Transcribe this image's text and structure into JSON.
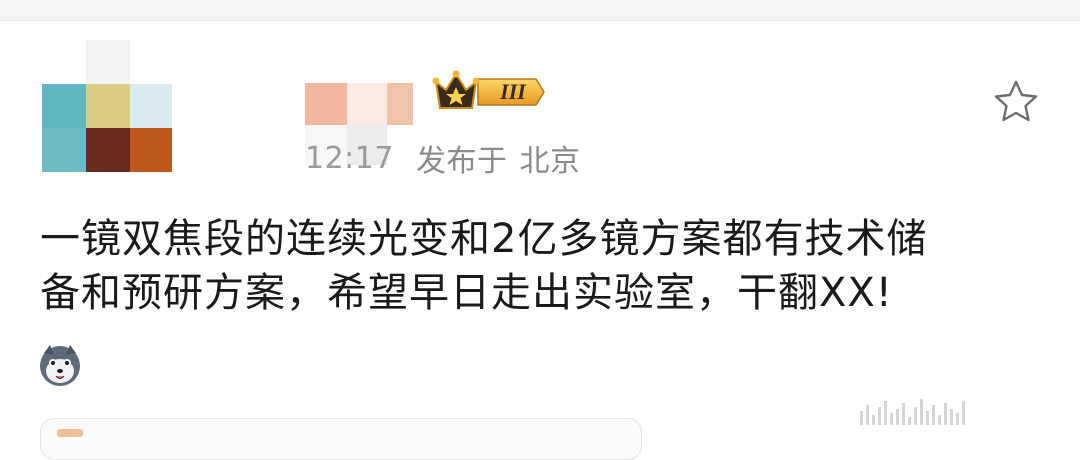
{
  "post": {
    "time": "12:17",
    "published_label": "发布于",
    "location": "北京",
    "badge_level": "III",
    "text_line1": "一镜双焦段的连续光变和2亿多镜方案都有技术储",
    "text_line2": "备和预研方案，希望早日走出实验室，干翻XX!"
  },
  "icons": {
    "favorite": "star-outline-icon",
    "badge": "crown-icon",
    "sticker": "husky-dog-emoji-icon"
  },
  "colors": {
    "text": "#1a1a1a",
    "meta": "#8a8a8a",
    "badge_gold": "#f3b63a",
    "badge_dark": "#3a2a1a"
  }
}
